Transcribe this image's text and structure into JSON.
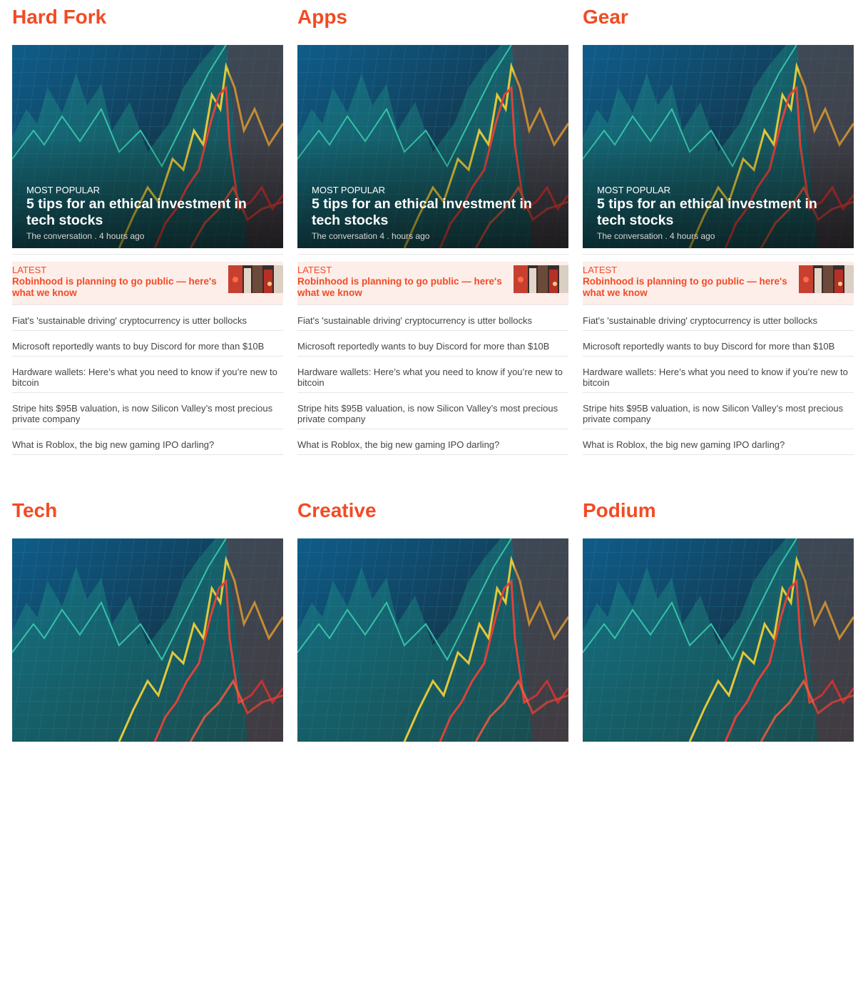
{
  "colors": {
    "accent": "#f24b24",
    "latest_bg": "#fdeeea",
    "divider": "#e6e6e6"
  },
  "sections": [
    {
      "title": "Hard Fork",
      "hero": {
        "kicker": "Most popular",
        "title": "5 tips for an ethical investment in tech stocks",
        "meta": "The conversation . 4 hours ago"
      },
      "latest": {
        "kicker": "Latest",
        "title": "Robinhood is planning to go public — here's what we know"
      },
      "items": [
        "Fiat's 'sustainable driving' cryptocurrency is utter bollocks",
        "Microsoft reportedly wants to buy Discord for more than $10B",
        "Hardware wallets: Here’s what you need to know if you’re new to bitcoin",
        "Stripe hits $95B valuation, is now Silicon Valley’s most precious private company",
        "What is Roblox, the big new gaming IPO darling?"
      ]
    },
    {
      "title": "Apps",
      "hero": {
        "kicker": "Most popular",
        "title": "5 tips for an ethical investment in tech stocks",
        "meta": "The conversation 4 . hours ago"
      },
      "latest": {
        "kicker": "Latest",
        "title": "Robinhood is planning to go public — here's what we know"
      },
      "items": [
        "Fiat's 'sustainable driving' cryptocurrency is utter bollocks",
        "Microsoft reportedly wants to buy Discord for more than $10B",
        "Hardware wallets: Here’s what you need to know if you’re new to bitcoin",
        "Stripe hits $95B valuation, is now Silicon Valley’s most precious private company",
        "What is Roblox, the big new gaming IPO darling?"
      ]
    },
    {
      "title": "Gear",
      "hero": {
        "kicker": "Most popular",
        "title": "5 tips for an ethical investment in tech stocks",
        "meta": "The conversation . 4 hours ago"
      },
      "latest": {
        "kicker": "Latest",
        "title": "Robinhood is planning to go public — here's what we know"
      },
      "items": [
        "Fiat's 'sustainable driving' cryptocurrency is utter bollocks",
        "Microsoft reportedly wants to buy Discord for more than $10B",
        "Hardware wallets: Here’s what you need to know if you’re new to bitcoin",
        "Stripe hits $95B valuation, is now Silicon Valley’s most precious private company",
        "What is Roblox, the big new gaming IPO darling?"
      ]
    },
    {
      "title": "Tech"
    },
    {
      "title": "Creative"
    },
    {
      "title": "Podium"
    }
  ]
}
